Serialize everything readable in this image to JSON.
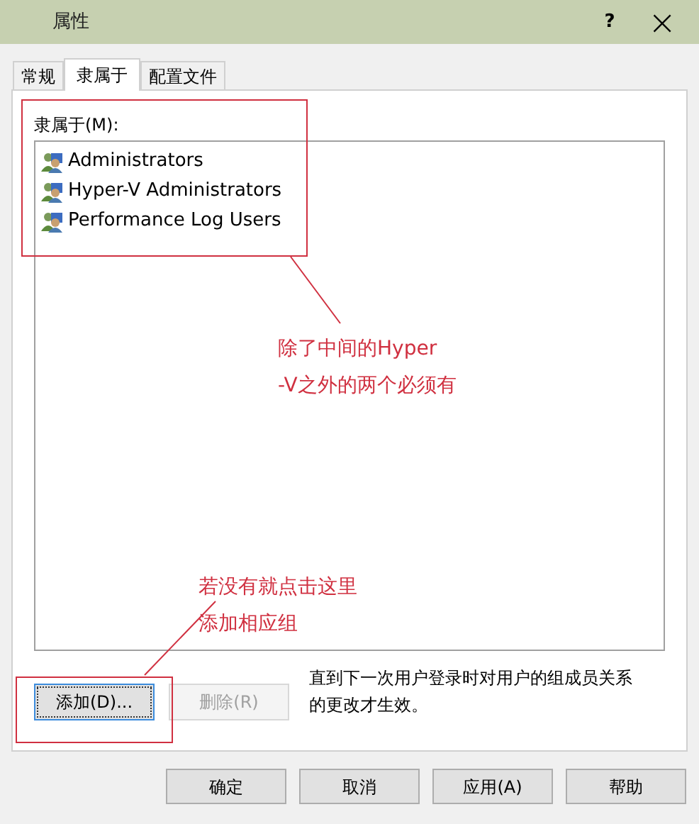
{
  "window": {
    "title": "属性",
    "help": "?",
    "close": "×"
  },
  "tabs": [
    {
      "label": "常规",
      "selected": false
    },
    {
      "label": "隶属于",
      "selected": true
    },
    {
      "label": "配置文件",
      "selected": false
    }
  ],
  "member_of": {
    "label": "隶属于(M):",
    "items": [
      "Administrators",
      "Hyper-V Administrators",
      "Performance Log Users"
    ]
  },
  "actions": [
    {
      "label": "添加(D)...",
      "disabled": false,
      "focused": true
    },
    {
      "label": "删除(R)",
      "disabled": true,
      "focused": false
    }
  ],
  "note": "直到下一次用户登录时对用户的组成员关系的更改才生效。",
  "buttons": [
    {
      "label": "确定"
    },
    {
      "label": "取消"
    },
    {
      "label": "应用(A)"
    },
    {
      "label": "帮助"
    }
  ],
  "annotations": [
    {
      "lines": [
        "除了中间的Hyper",
        "-V之外的两个必须有"
      ]
    },
    {
      "lines": [
        "若没有就点击这里",
        "添加相应组"
      ]
    }
  ]
}
